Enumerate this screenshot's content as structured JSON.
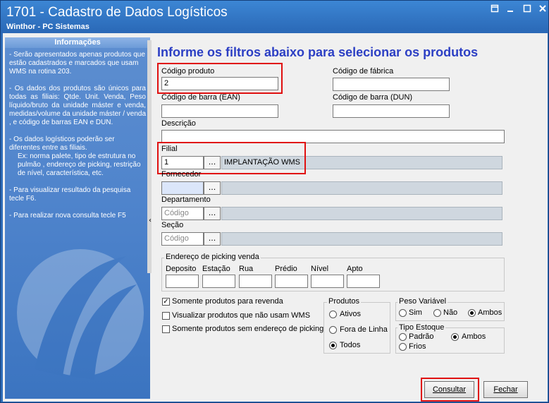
{
  "window": {
    "title": "1701 - Cadastro de Dados Logísticos",
    "subtitle": "Winthor - PC Sistemas",
    "restore_icon": "restore-icon",
    "minimize_icon": "minimize-icon",
    "close_icon": "close-icon"
  },
  "info": {
    "header": "Informações",
    "p1": "- Serão apresentados apenas produtos que estão cadastrados e marcados que usam WMS na rotina 203.",
    "p2": "- Os dados dos produtos são únicos para todas as filiais: Qtde. Unit. Venda, Peso líquido/bruto da unidade máster e venda, medidas/volume da unidade máster / venda , e código de barras EAN e DUN.",
    "p3a": "- Os dados logísticos poderão ser diferentes entre as filiais.",
    "p3b": "Ex: norma palete, tipo de estrutura no pulmão , endereço de picking, restrição de nível, característica, etc.",
    "p4": "- Para visualizar resultado da pesquisa tecle F6.",
    "p5": "- Para realizar nova consulta tecle F5"
  },
  "form": {
    "heading": "Informe os filtros abaixo para selecionar os produtos",
    "codigo_produto_label": "Código produto",
    "codigo_produto_value": "2",
    "codigo_fabrica_label": "Código de fábrica",
    "codigo_fabrica_value": "",
    "ean_label": "Código de barra (EAN)",
    "ean_value": "",
    "dun_label": "Código de barra (DUN)",
    "dun_value": "",
    "descricao_label": "Descrição",
    "descricao_value": "",
    "filial_label": "Filial",
    "filial_value": "1",
    "filial_desc": "IMPLANTAÇÃO WMS",
    "fornecedor_label": "Fornecedor",
    "fornecedor_value": "",
    "departamento_label": "Departamento",
    "departamento_placeholder": "Código",
    "secao_label": "Seção",
    "secao_placeholder": "Código",
    "lookup_label": "...",
    "picking_title": "Endereço de picking venda",
    "picking_fields": [
      "Deposito",
      "Estação",
      "Rua",
      "Prédio",
      "Nível",
      "Apto"
    ]
  },
  "options": {
    "somente_revenda": "Somente produtos para revenda",
    "visualizar_nao_wms": "Visualizar produtos que não usam WMS",
    "sem_picking": "Somente produtos sem endereço de picking",
    "checked_mark": "✓",
    "produtos_title": "Produtos",
    "produtos": [
      "Ativos",
      "Fora de Linha",
      "Todos"
    ],
    "peso_title": "Peso Variável",
    "peso": [
      "Sim",
      "Não",
      "Ambos"
    ],
    "tipo_title": "Tipo Estoque",
    "tipo": [
      "Padrão",
      "Ambos",
      "Frios"
    ]
  },
  "buttons": {
    "consultar": "Consultar",
    "fechar": "Fechar"
  },
  "colors": {
    "heading": "#2c3fc4",
    "highlight": "#e01010",
    "titlebar": "#2a68b6"
  }
}
